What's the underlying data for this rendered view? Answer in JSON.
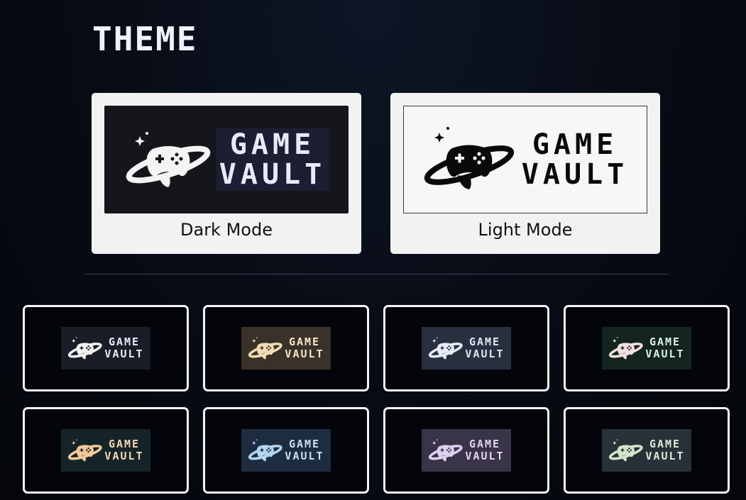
{
  "page": {
    "title": "THEME"
  },
  "modes": [
    {
      "label": "Dark Mode",
      "logo_line1": "GAME",
      "logo_line2": "VAULT",
      "logo_icon": "planet-controller-icon"
    },
    {
      "label": "Light Mode",
      "logo_line1": "GAME",
      "logo_line2": "VAULT",
      "logo_icon": "planet-controller-icon"
    }
  ],
  "themes": [
    {
      "logo_line1": "GAME",
      "logo_line2": "VAULT",
      "bg": "#1a1c28",
      "fg": "#e8ebf7",
      "icon": "#f2f2f2"
    },
    {
      "logo_line1": "GAME",
      "logo_line2": "VAULT",
      "bg": "#3a3128",
      "fg": "#f5e6c8",
      "icon": "#f0dcb4"
    },
    {
      "logo_line1": "GAME",
      "logo_line2": "VAULT",
      "bg": "#283040",
      "fg": "#dfe6f2",
      "icon": "#e6ebf5"
    },
    {
      "logo_line1": "GAME",
      "logo_line2": "VAULT",
      "bg": "#13241e",
      "fg": "#d9f0e6",
      "icon": "#f5dede"
    },
    {
      "logo_line1": "GAME",
      "logo_line2": "VAULT",
      "bg": "#152428",
      "fg": "#f2d9b4",
      "icon": "#f2c89a"
    },
    {
      "logo_line1": "GAME",
      "logo_line2": "VAULT",
      "bg": "#1e2c40",
      "fg": "#c8dff2",
      "icon": "#b4d4f0"
    },
    {
      "logo_line1": "GAME",
      "logo_line2": "VAULT",
      "bg": "#3a3448",
      "fg": "#e2d4f2",
      "icon": "#dcd0f0"
    },
    {
      "logo_line1": "GAME",
      "logo_line2": "VAULT",
      "bg": "#283038",
      "fg": "#d8ecd8",
      "icon": "#d0e6c8"
    }
  ]
}
